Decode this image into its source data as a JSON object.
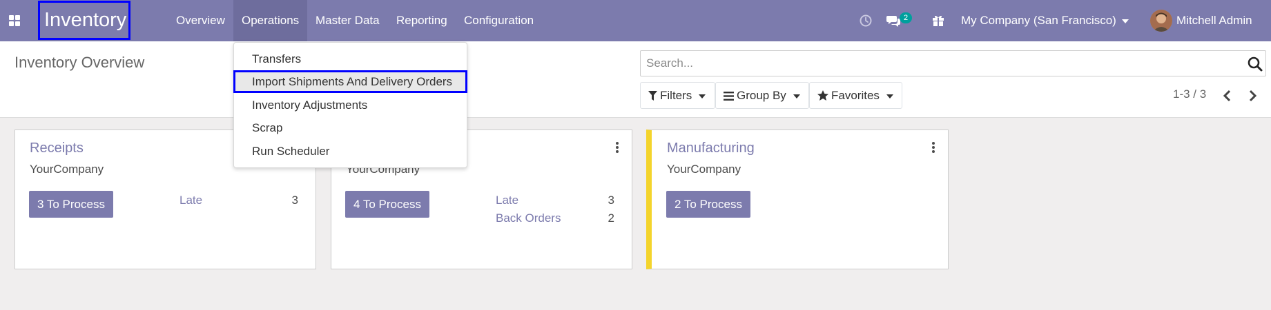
{
  "navbar": {
    "app_name": "Inventory",
    "menus": [
      {
        "label": "Overview"
      },
      {
        "label": "Operations"
      },
      {
        "label": "Master Data"
      },
      {
        "label": "Reporting"
      },
      {
        "label": "Configuration"
      }
    ],
    "messages_count": "2",
    "company": "My Company (San Francisco)",
    "user": "Mitchell Admin"
  },
  "operations_dropdown": {
    "items": [
      {
        "label": "Transfers"
      },
      {
        "label": "Import Shipments And Delivery Orders"
      },
      {
        "label": "Inventory Adjustments"
      },
      {
        "label": "Scrap"
      },
      {
        "label": "Run Scheduler"
      }
    ]
  },
  "control_panel": {
    "title": "Inventory Overview",
    "search_placeholder": "Search...",
    "filters_label": "Filters",
    "group_by_label": "Group By",
    "favorites_label": "Favorites",
    "pager": "1-3 / 3"
  },
  "cards": [
    {
      "title": "Receipts",
      "company": "YourCompany",
      "process_button": "3 To Process",
      "stats": [
        {
          "label": "Late",
          "value": "3"
        }
      ]
    },
    {
      "title": "",
      "company": "YourCompany",
      "process_button": "4 To Process",
      "stats": [
        {
          "label": "Late",
          "value": "3"
        },
        {
          "label": "Back Orders",
          "value": "2"
        }
      ]
    },
    {
      "title": "Manufacturing",
      "company": "YourCompany",
      "process_button": "2 To Process",
      "stats": []
    }
  ],
  "colors": {
    "brand": "#7c7bad",
    "highlight_border": "#0000ff",
    "badge": "#00a09d",
    "card_accent": "#f4d42c"
  }
}
